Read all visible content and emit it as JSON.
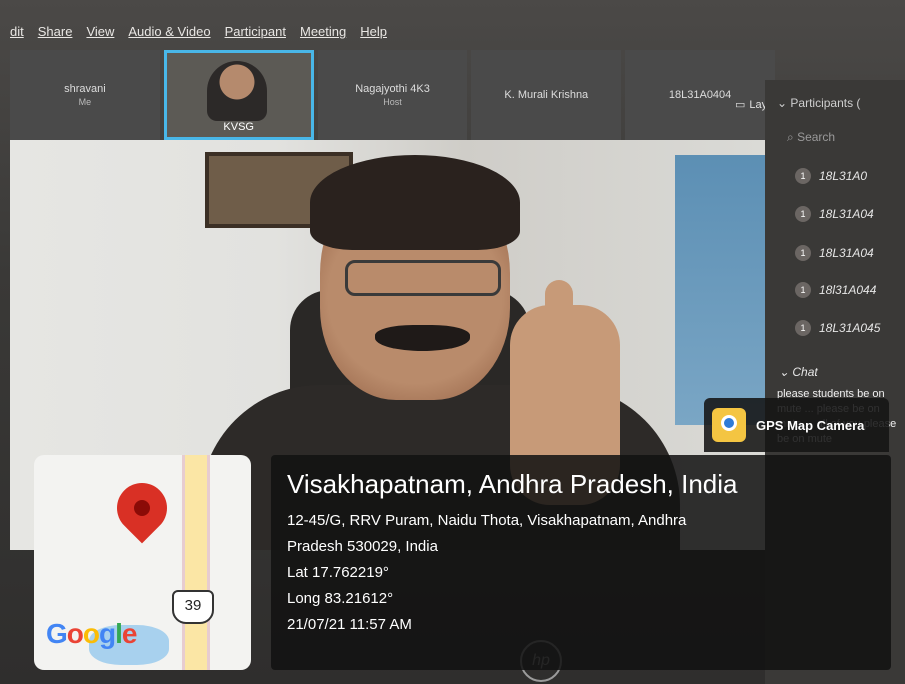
{
  "menu": [
    "dit",
    "Share",
    "View",
    "Audio & Video",
    "Participant",
    "Meeting",
    "Help"
  ],
  "thumbnails": [
    {
      "name": "shravani",
      "sub": "Me"
    },
    {
      "name": "KVSG",
      "active": true
    },
    {
      "name": "Nagajyothi 4K3",
      "sub": "Host"
    },
    {
      "name": "K. Murali Krishna"
    },
    {
      "name": "18L31A0404"
    }
  ],
  "layout_label": "Layout",
  "participants": {
    "title": "Participants (",
    "search_placeholder": "Search",
    "items": [
      "18L31A0",
      "18L31A04",
      "18L31A04",
      "18l31A044",
      "18L31A045"
    ]
  },
  "chat": {
    "title": "Chat",
    "message": "please students be on mute ... please be on mute ... all of you please be on mute"
  },
  "gps_badge": {
    "label": "GPS Map Camera",
    "icon": "camera-pin-icon"
  },
  "map": {
    "route_shield": "39",
    "logo": "Google",
    "colors": {
      "pin": "#d93025",
      "road": "#fbe6a5",
      "water": "#a8d1ee"
    }
  },
  "location": {
    "city": "Visakhapatnam, Andhra Pradesh, India",
    "address_line1": "12-45/G, RRV Puram, Naidu Thota, Visakhapatnam, Andhra",
    "address_line2": "Pradesh 530029, India",
    "lat": "Lat 17.762219°",
    "long": "Long 83.21612°",
    "datetime": "21/07/21 11:57 AM"
  },
  "brand": "hp"
}
